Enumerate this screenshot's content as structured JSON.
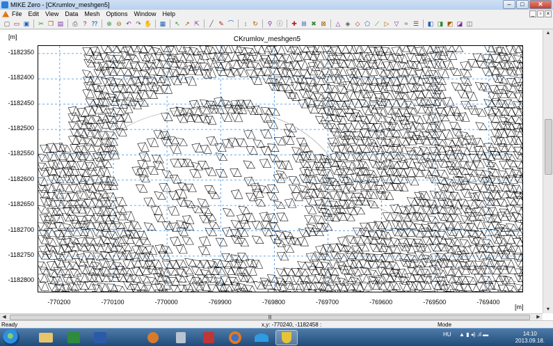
{
  "window": {
    "title": "MIKE Zero - [CKrumlov_meshgen5]"
  },
  "menu": [
    "File",
    "Edit",
    "View",
    "Data",
    "Mesh",
    "Options",
    "Window",
    "Help"
  ],
  "toolbar_icons": [
    "new-icon",
    "open-icon",
    "save-icon",
    "sep",
    "cut-icon",
    "copy-icon",
    "paste-icon",
    "sep",
    "print-icon",
    "help-icon",
    "context-help-icon",
    "sep",
    "zoom-in-icon",
    "zoom-out-icon",
    "zoom-previous-icon",
    "zoom-next-icon",
    "pan-icon",
    "sep",
    "grid-icon",
    "sep",
    "select-icon",
    "select-node-icon",
    "select-element-icon",
    "sep",
    "draw-line-icon",
    "edit-line-icon",
    "edit-arc-icon",
    "sep",
    "move-icon",
    "rotate-icon",
    "sep",
    "find-icon",
    "node-info-icon",
    "sep",
    "add-node-icon",
    "add-arc-icon",
    "delete-node-icon",
    "delete-arc-icon",
    "sep",
    "triangulate-icon",
    "smooth-icon",
    "refine-icon",
    "polygon-icon",
    "polyline-icon",
    "triangle-icon",
    "edit-mesh-icon",
    "interpolate-icon",
    "layer-icon",
    "sep",
    "export-icon",
    "export2-icon",
    "export3-icon",
    "export4-icon",
    "export5-icon"
  ],
  "plot": {
    "title": "CKrumlov_meshgen5",
    "y_unit": "[m]",
    "x_unit": "[m]"
  },
  "chart_data": {
    "type": "mesh",
    "title": "CKrumlov_meshgen5",
    "xlabel": "[m]",
    "ylabel": "[m]",
    "x_ticks": [
      -770200,
      -770100,
      -770000,
      -769900,
      -769800,
      -769700,
      -769600,
      -769500,
      -769400
    ],
    "y_ticks": [
      -1182350,
      -1182400,
      -1182450,
      -1182500,
      -1182550,
      -1182600,
      -1182650,
      -1182700,
      -1182750,
      -1182800
    ],
    "xlim": [
      -770240,
      -769335
    ],
    "ylim": [
      -1182823,
      -1182335
    ],
    "grid": true
  },
  "status": {
    "left": "Ready",
    "coords": "x,y: -770240, -1182458 :",
    "mode": "Mode"
  },
  "taskbar": {
    "tray_lang": "HU",
    "time": "14:10",
    "date": "2013.09.18."
  }
}
